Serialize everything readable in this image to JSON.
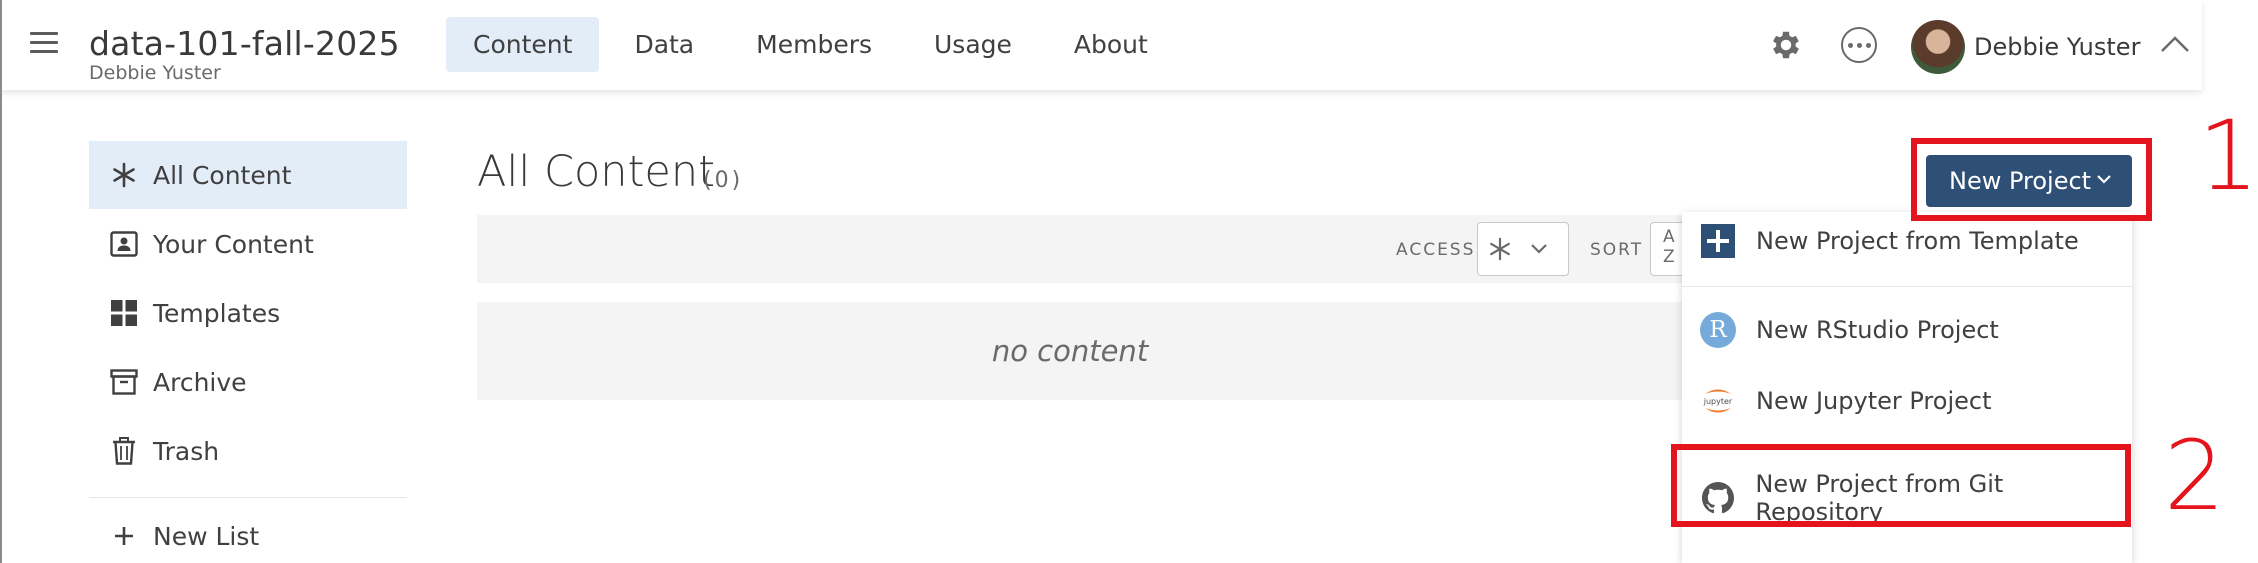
{
  "header": {
    "space_title": "data-101-fall-2025",
    "space_owner": "Debbie Yuster",
    "tabs": [
      {
        "label": "Content",
        "active": true
      },
      {
        "label": "Data"
      },
      {
        "label": "Members"
      },
      {
        "label": "Usage"
      },
      {
        "label": "About"
      }
    ],
    "user_name": "Debbie Yuster",
    "icons": [
      "hamburger-icon",
      "gear-icon",
      "more-options-icon",
      "chevron-up-icon"
    ]
  },
  "sidebar": {
    "items": [
      {
        "label": "All Content",
        "icon": "asterisk-icon",
        "active": true
      },
      {
        "label": "Your Content",
        "icon": "user-badge-icon"
      },
      {
        "label": "Templates",
        "icon": "grid-icon"
      },
      {
        "label": "Archive",
        "icon": "archive-box-icon"
      },
      {
        "label": "Trash",
        "icon": "trash-icon"
      }
    ],
    "new_list_label": "New List"
  },
  "main": {
    "title": "All Content",
    "count": "(0)",
    "filters": {
      "access_label": "ACCESS",
      "sort_label": "SORT",
      "sort_value": "A\nZ"
    },
    "empty_text": "no content"
  },
  "new_project": {
    "button_label": "New Project",
    "menu": [
      {
        "label": "New Project from Template",
        "icon": "plus-square-icon"
      },
      {
        "label": "New RStudio Project",
        "icon": "rstudio-logo-icon"
      },
      {
        "label": "New Jupyter Project",
        "icon": "jupyter-logo-icon"
      },
      {
        "label": "New Project from Git Repository",
        "icon": "github-icon"
      }
    ]
  },
  "annotations": {
    "marker_1": "1",
    "marker_2": "2",
    "color": "#e3141c"
  },
  "colors": {
    "primary_button": "#2f5076",
    "active_bg": "#e3edf7",
    "panel_bg": "#f4f4f4"
  }
}
